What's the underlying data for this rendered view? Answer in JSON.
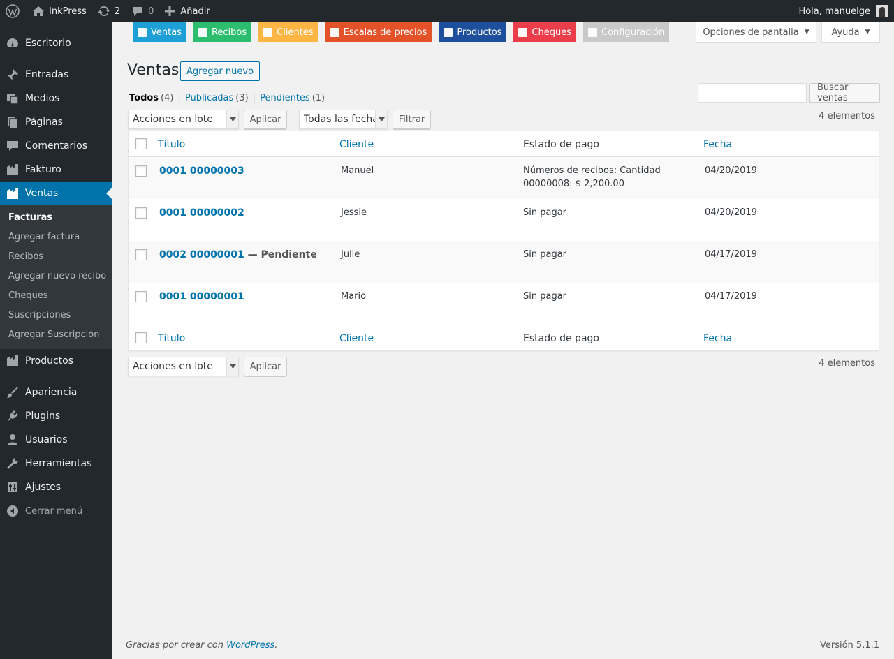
{
  "adminbar": {
    "site_name": "InkPress",
    "updates_count": "2",
    "comments_count": "0",
    "new_label": "Añadir",
    "greeting": "Hola, manuelge"
  },
  "sidebar": {
    "items": [
      {
        "label": "Escritorio",
        "icon": "dashboard-icon"
      },
      {
        "label": "Entradas",
        "icon": "pin-icon"
      },
      {
        "label": "Medios",
        "icon": "media-icon"
      },
      {
        "label": "Páginas",
        "icon": "pages-icon"
      },
      {
        "label": "Comentarios",
        "icon": "comments-icon"
      },
      {
        "label": "Fakturo",
        "icon": "fakturo-icon"
      },
      {
        "label": "Ventas",
        "icon": "fakturo-icon"
      },
      {
        "label": "Productos",
        "icon": "fakturo-icon"
      },
      {
        "label": "Apariencia",
        "icon": "brush-icon"
      },
      {
        "label": "Plugins",
        "icon": "plugin-icon"
      },
      {
        "label": "Usuarios",
        "icon": "users-icon"
      },
      {
        "label": "Herramientas",
        "icon": "wrench-icon"
      },
      {
        "label": "Ajustes",
        "icon": "settings-icon"
      }
    ],
    "submenu": [
      "Facturas",
      "Agregar factura",
      "Recibos",
      "Agregar nuevo recibo",
      "Cheques",
      "Suscripciones",
      "Agregar Suscripción"
    ],
    "collapse_label": "Cerrar menú"
  },
  "tabs": [
    {
      "label": "Ventas",
      "color": "#1e9fd5"
    },
    {
      "label": "Recibos",
      "color": "#2dbd6f"
    },
    {
      "label": "Clientes",
      "color": "#fdb643"
    },
    {
      "label": "Escalas de precios",
      "color": "#e4522a"
    },
    {
      "label": "Productos",
      "color": "#1e4f9c"
    },
    {
      "label": "Cheques",
      "color": "#eb3e4a"
    },
    {
      "label": "Configuración",
      "color": "#c7c7c7"
    }
  ],
  "screen_options_label": "Opciones de pantalla",
  "help_label": "Ayuda",
  "page": {
    "title": "Ventas",
    "add_new": "Agregar nuevo"
  },
  "views": [
    {
      "label": "Todos",
      "count": "(4)"
    },
    {
      "label": "Publicadas",
      "count": "(3)"
    },
    {
      "label": "Pendientes",
      "count": "(1)"
    }
  ],
  "search": {
    "placeholder": "",
    "button": "Buscar ventas"
  },
  "tablenav": {
    "bulk_actions": "Acciones en lote",
    "apply": "Aplicar",
    "all_dates": "Todas las fechas",
    "filter": "Filtrar",
    "items_count": "4 elementos"
  },
  "table": {
    "columns": {
      "title": "Título",
      "client": "Cliente",
      "state": "Estado de pago",
      "date": "Fecha"
    },
    "rows": [
      {
        "title": "0001 00000003",
        "state_suffix": "",
        "client": "Manuel",
        "payment": "Números de recibos: Cantidad 00000008: $ 2,200.00",
        "date": "04/20/2019"
      },
      {
        "title": "0001 00000002",
        "state_suffix": "",
        "client": "Jessie",
        "payment": "Sin pagar",
        "date": "04/20/2019"
      },
      {
        "title": "0002 00000001",
        "state_suffix": "— Pendiente",
        "client": "Julie",
        "payment": "Sin pagar",
        "date": "04/17/2019"
      },
      {
        "title": "0001 00000001",
        "state_suffix": "",
        "client": "Mario",
        "payment": "Sin pagar",
        "date": "04/17/2019"
      }
    ]
  },
  "footer": {
    "thanks_prefix": "Gracias por crear con ",
    "wordpress_link": "WordPress",
    "thanks_suffix": ".",
    "version": "Versión 5.1.1"
  }
}
